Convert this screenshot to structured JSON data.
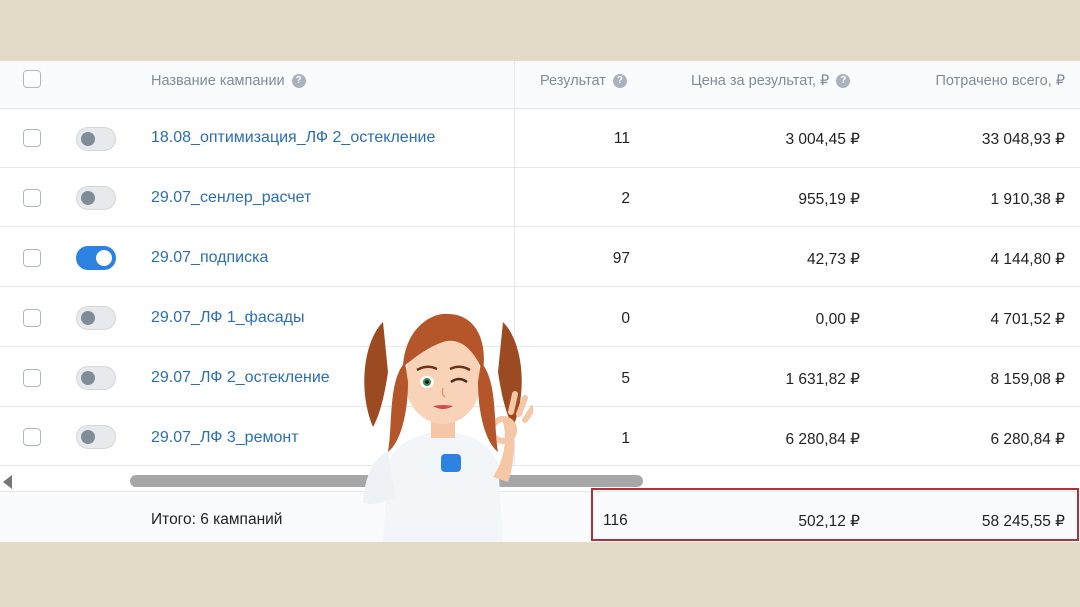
{
  "header": {
    "campaign_name": "Название кампании",
    "result": "Результат",
    "price_per_result": "Цена за результат, ₽",
    "spent_total": "Потрачено всего, ₽",
    "help_glyph": "?"
  },
  "rows": [
    {
      "name": "18.08_оптимизация_ЛФ 2_остекление",
      "active": false,
      "result": "11",
      "price": "3 004,45 ₽",
      "spent": "33 048,93 ₽"
    },
    {
      "name": "29.07_сенлер_расчет",
      "active": false,
      "result": "2",
      "price": "955,19 ₽",
      "spent": "1 910,38 ₽"
    },
    {
      "name": "29.07_подписка",
      "active": true,
      "result": "97",
      "price": "42,73 ₽",
      "spent": "4 144,80 ₽"
    },
    {
      "name": "29.07_ЛФ 1_фасады",
      "active": false,
      "result": "0",
      "price": "0,00 ₽",
      "spent": "4 701,52 ₽"
    },
    {
      "name": "29.07_ЛФ 2_остекление",
      "active": false,
      "result": "5",
      "price": "1 631,82 ₽",
      "spent": "8 159,08 ₽"
    },
    {
      "name": "29.07_ЛФ 3_ремонт",
      "active": false,
      "result": "1",
      "price": "6 280,84 ₽",
      "spent": "6 280,84 ₽"
    }
  ],
  "totals": {
    "label": "Итого: 6 кампаний",
    "result": "116",
    "price": "502,12 ₽",
    "spent": "58 245,55 ₽"
  },
  "colors": {
    "background": "#e3dac8",
    "link": "#2a6eb7",
    "toggle_on": "#2d81e0",
    "highlight_border": "#a8333b"
  },
  "icons": {
    "help": "help-icon",
    "scroll_left": "arrow-left-icon"
  }
}
